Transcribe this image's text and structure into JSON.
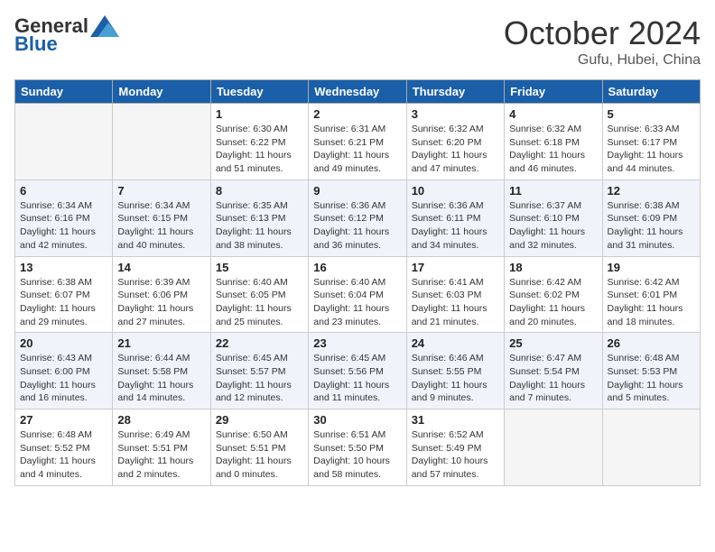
{
  "header": {
    "logo_general": "General",
    "logo_blue": "Blue",
    "month": "October 2024",
    "location": "Gufu, Hubei, China"
  },
  "days_of_week": [
    "Sunday",
    "Monday",
    "Tuesday",
    "Wednesday",
    "Thursday",
    "Friday",
    "Saturday"
  ],
  "weeks": [
    [
      {
        "day": "",
        "info": ""
      },
      {
        "day": "",
        "info": ""
      },
      {
        "day": "1",
        "info": "Sunrise: 6:30 AM\nSunset: 6:22 PM\nDaylight: 11 hours and 51 minutes."
      },
      {
        "day": "2",
        "info": "Sunrise: 6:31 AM\nSunset: 6:21 PM\nDaylight: 11 hours and 49 minutes."
      },
      {
        "day": "3",
        "info": "Sunrise: 6:32 AM\nSunset: 6:20 PM\nDaylight: 11 hours and 47 minutes."
      },
      {
        "day": "4",
        "info": "Sunrise: 6:32 AM\nSunset: 6:18 PM\nDaylight: 11 hours and 46 minutes."
      },
      {
        "day": "5",
        "info": "Sunrise: 6:33 AM\nSunset: 6:17 PM\nDaylight: 11 hours and 44 minutes."
      }
    ],
    [
      {
        "day": "6",
        "info": "Sunrise: 6:34 AM\nSunset: 6:16 PM\nDaylight: 11 hours and 42 minutes."
      },
      {
        "day": "7",
        "info": "Sunrise: 6:34 AM\nSunset: 6:15 PM\nDaylight: 11 hours and 40 minutes."
      },
      {
        "day": "8",
        "info": "Sunrise: 6:35 AM\nSunset: 6:13 PM\nDaylight: 11 hours and 38 minutes."
      },
      {
        "day": "9",
        "info": "Sunrise: 6:36 AM\nSunset: 6:12 PM\nDaylight: 11 hours and 36 minutes."
      },
      {
        "day": "10",
        "info": "Sunrise: 6:36 AM\nSunset: 6:11 PM\nDaylight: 11 hours and 34 minutes."
      },
      {
        "day": "11",
        "info": "Sunrise: 6:37 AM\nSunset: 6:10 PM\nDaylight: 11 hours and 32 minutes."
      },
      {
        "day": "12",
        "info": "Sunrise: 6:38 AM\nSunset: 6:09 PM\nDaylight: 11 hours and 31 minutes."
      }
    ],
    [
      {
        "day": "13",
        "info": "Sunrise: 6:38 AM\nSunset: 6:07 PM\nDaylight: 11 hours and 29 minutes."
      },
      {
        "day": "14",
        "info": "Sunrise: 6:39 AM\nSunset: 6:06 PM\nDaylight: 11 hours and 27 minutes."
      },
      {
        "day": "15",
        "info": "Sunrise: 6:40 AM\nSunset: 6:05 PM\nDaylight: 11 hours and 25 minutes."
      },
      {
        "day": "16",
        "info": "Sunrise: 6:40 AM\nSunset: 6:04 PM\nDaylight: 11 hours and 23 minutes."
      },
      {
        "day": "17",
        "info": "Sunrise: 6:41 AM\nSunset: 6:03 PM\nDaylight: 11 hours and 21 minutes."
      },
      {
        "day": "18",
        "info": "Sunrise: 6:42 AM\nSunset: 6:02 PM\nDaylight: 11 hours and 20 minutes."
      },
      {
        "day": "19",
        "info": "Sunrise: 6:42 AM\nSunset: 6:01 PM\nDaylight: 11 hours and 18 minutes."
      }
    ],
    [
      {
        "day": "20",
        "info": "Sunrise: 6:43 AM\nSunset: 6:00 PM\nDaylight: 11 hours and 16 minutes."
      },
      {
        "day": "21",
        "info": "Sunrise: 6:44 AM\nSunset: 5:58 PM\nDaylight: 11 hours and 14 minutes."
      },
      {
        "day": "22",
        "info": "Sunrise: 6:45 AM\nSunset: 5:57 PM\nDaylight: 11 hours and 12 minutes."
      },
      {
        "day": "23",
        "info": "Sunrise: 6:45 AM\nSunset: 5:56 PM\nDaylight: 11 hours and 11 minutes."
      },
      {
        "day": "24",
        "info": "Sunrise: 6:46 AM\nSunset: 5:55 PM\nDaylight: 11 hours and 9 minutes."
      },
      {
        "day": "25",
        "info": "Sunrise: 6:47 AM\nSunset: 5:54 PM\nDaylight: 11 hours and 7 minutes."
      },
      {
        "day": "26",
        "info": "Sunrise: 6:48 AM\nSunset: 5:53 PM\nDaylight: 11 hours and 5 minutes."
      }
    ],
    [
      {
        "day": "27",
        "info": "Sunrise: 6:48 AM\nSunset: 5:52 PM\nDaylight: 11 hours and 4 minutes."
      },
      {
        "day": "28",
        "info": "Sunrise: 6:49 AM\nSunset: 5:51 PM\nDaylight: 11 hours and 2 minutes."
      },
      {
        "day": "29",
        "info": "Sunrise: 6:50 AM\nSunset: 5:51 PM\nDaylight: 11 hours and 0 minutes."
      },
      {
        "day": "30",
        "info": "Sunrise: 6:51 AM\nSunset: 5:50 PM\nDaylight: 10 hours and 58 minutes."
      },
      {
        "day": "31",
        "info": "Sunrise: 6:52 AM\nSunset: 5:49 PM\nDaylight: 10 hours and 57 minutes."
      },
      {
        "day": "",
        "info": ""
      },
      {
        "day": "",
        "info": ""
      }
    ]
  ]
}
